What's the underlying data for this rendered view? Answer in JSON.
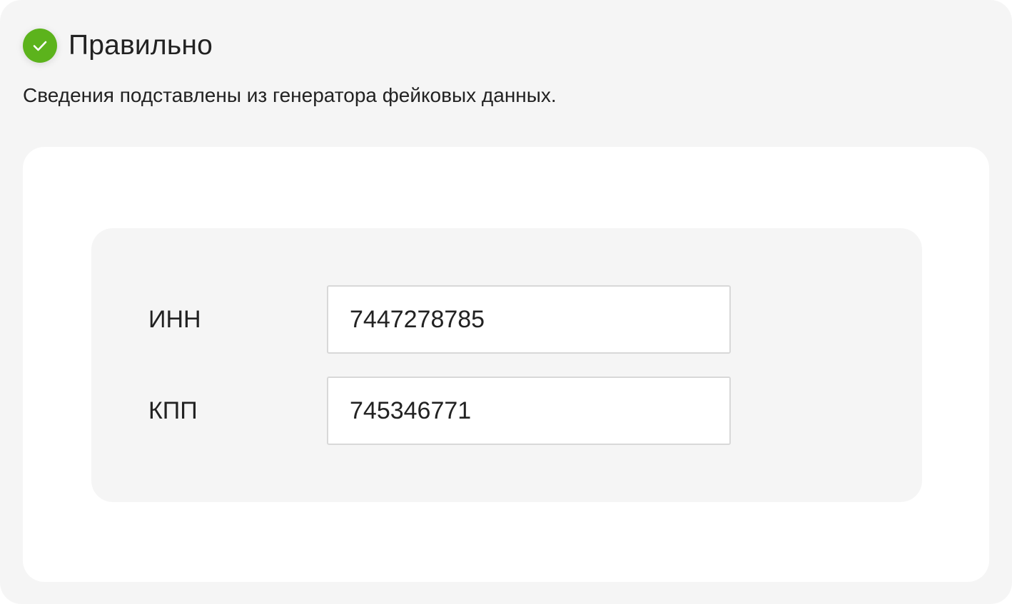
{
  "status": {
    "title": "Правильно",
    "icon": "check-circle-icon",
    "color": "#5cb31c"
  },
  "description": "Сведения подставлены из генератора фейковых данных.",
  "form": {
    "fields": [
      {
        "label": "ИНН",
        "value": "7447278785"
      },
      {
        "label": "КПП",
        "value": "745346771"
      }
    ]
  }
}
